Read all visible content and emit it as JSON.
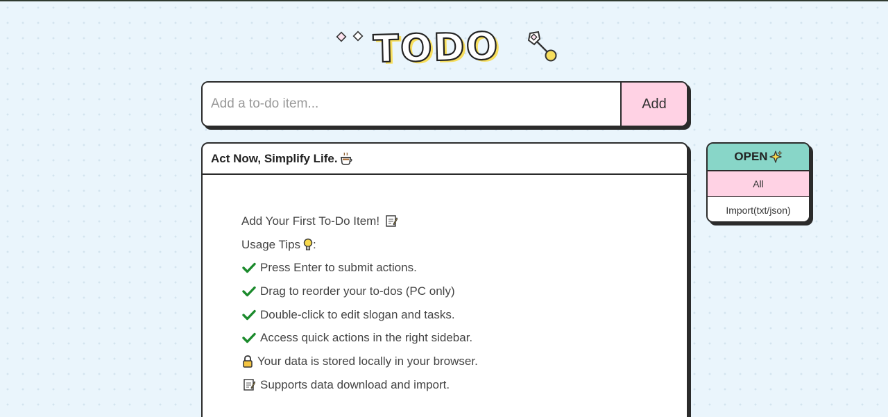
{
  "logo": {
    "text": "TODO",
    "icons": [
      "diamond-icon",
      "diamond-icon",
      "key-icon"
    ]
  },
  "input": {
    "placeholder": "Add a to-do item...",
    "value": ""
  },
  "add_button": {
    "label": "Add"
  },
  "card": {
    "slogan": "Act Now, Simplify Life.",
    "slogan_icon": "coffee-icon",
    "tips": [
      {
        "icon": "memo-icon",
        "text": "Add Your First To-Do Item!"
      },
      {
        "icon": "bulb-icon",
        "text": "Usage Tips"
      },
      {
        "icon": "check-icon",
        "text": "Press Enter to submit actions."
      },
      {
        "icon": "check-icon",
        "text": "Drag to reorder your to-dos (PC only)"
      },
      {
        "icon": "check-icon",
        "text": "Double-click to edit slogan and tasks."
      },
      {
        "icon": "check-icon",
        "text": "Access quick actions in the right sidebar."
      },
      {
        "icon": "lock-icon",
        "text": "Your data is stored locally in your browser."
      },
      {
        "icon": "memo-icon",
        "text": "Supports data download and import."
      }
    ]
  },
  "sidebar": {
    "title": "OPEN",
    "title_icon": "sparkle-icon",
    "items": [
      {
        "label": "All"
      },
      {
        "label": "Import(txt/json)"
      }
    ]
  },
  "colors": {
    "background": "#eaf5fc",
    "accent_pink": "#ffd2e4",
    "accent_teal": "#88d6c8",
    "logo_yellow": "#f7de5d",
    "check_green": "#1b8a2c"
  }
}
